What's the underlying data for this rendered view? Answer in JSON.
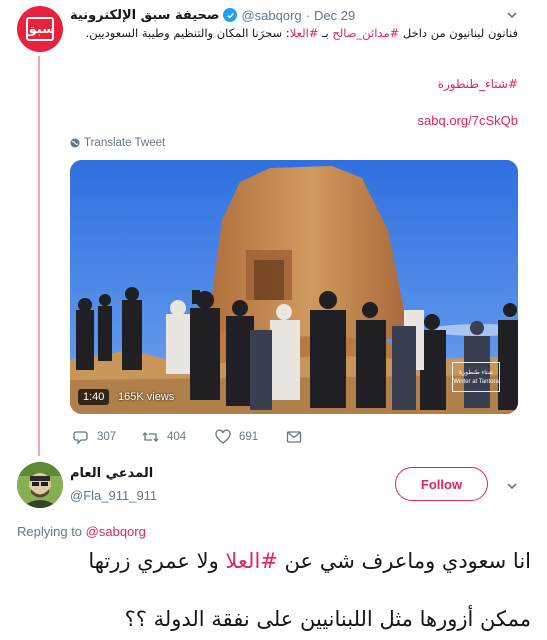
{
  "tweet": {
    "author_name": "صحيفة سبق الإلكترونية",
    "handle": "@sabqorg",
    "separator": "·",
    "date": "Dec 29",
    "text_part1": "فنانون لبنانيون من داخل ",
    "hashtag1": "#مدائن_صالح",
    "text_part2": " بـ ",
    "hashtag2": "#العلا",
    "text_part3": ": سحرَنا المكان والتنظيم وطيبة السعوديين.",
    "hashtag3": "#شتاء_طنطورة",
    "link": "sabq.org/7cSkQb",
    "translate_label": "Translate Tweet",
    "video": {
      "duration": "1:40",
      "views": "165K views",
      "brand_line1": "شتاء طنطورة",
      "brand_line2": "Winter at Tantora"
    },
    "actions": {
      "replies": "307",
      "retweets": "404",
      "likes": "691"
    }
  },
  "reply": {
    "display_name": "المدعي العام",
    "handle": "@Fla_911_911",
    "follow_label": "Follow",
    "replying_prefix": "Replying to ",
    "replying_handle": "@sabqorg",
    "line1_part1": "انا سعودي وماعرف شي عن ",
    "line1_hashtag": "#العلا",
    "line1_part2": " ولا عمري زرتها",
    "line2": "ممكن أزورها مثل اللبنانيين على نفقة الدولة ؟؟"
  },
  "colors": {
    "accent": "#e0245e",
    "verified": "#1da1f2",
    "muted": "#657786",
    "brand_red": "#e8213c"
  },
  "icons": [
    "sabq-logo",
    "verified-badge-icon",
    "chevron-down-icon",
    "globe-icon",
    "reply-icon",
    "retweet-icon",
    "like-icon",
    "share-icon"
  ]
}
